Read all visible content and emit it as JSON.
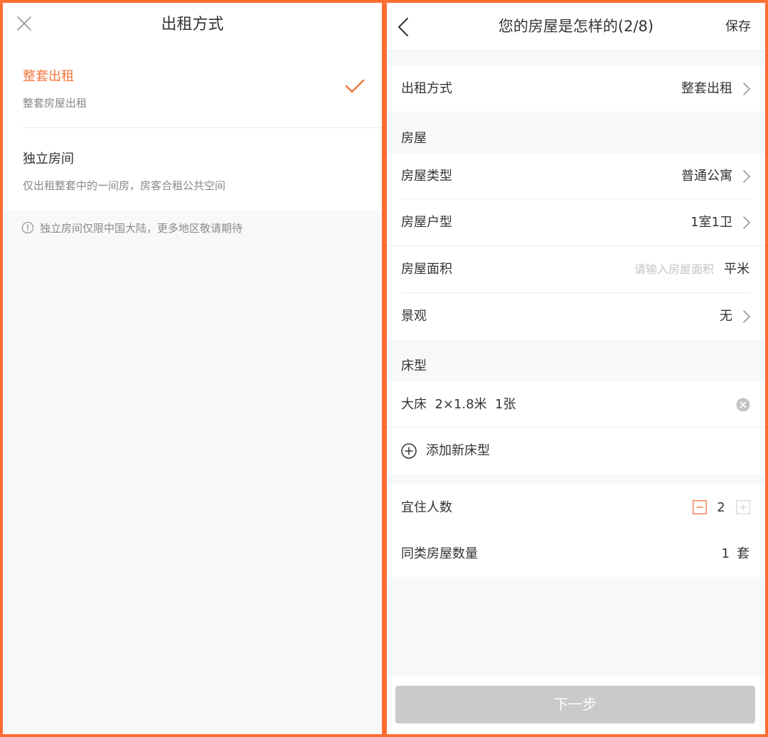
{
  "left": {
    "title": "出租方式",
    "options": [
      {
        "title": "整套出租",
        "subtitle": "整套房屋出租",
        "selected": true
      },
      {
        "title": "独立房间",
        "subtitle": "仅出租整套中的一间房，房客合租公共空间",
        "selected": false
      }
    ],
    "notice": "独立房间仅限中国大陆，更多地区敬请期待"
  },
  "right": {
    "title": "您的房屋是怎样的(2/8)",
    "save_label": "保存",
    "rental_method": {
      "label": "出租方式",
      "value": "整套出租"
    },
    "house_section": "房屋",
    "house_type": {
      "label": "房屋类型",
      "value": "普通公寓"
    },
    "layout": {
      "label": "房屋户型",
      "value": "1室1卫"
    },
    "area": {
      "label": "房屋面积",
      "placeholder": "请输入房屋面积",
      "unit": "平米"
    },
    "view": {
      "label": "景观",
      "value": "无"
    },
    "bed_section": "床型",
    "bed_item": "大床  2×1.8米  1张",
    "add_bed_label": "添加新床型",
    "guests": {
      "label": "宜住人数",
      "value": "2"
    },
    "room_count": {
      "label": "同类房屋数量",
      "value": "1",
      "unit": "套"
    },
    "next_label": "下一步"
  },
  "colors": {
    "accent": "#f5753a",
    "frame": "#ff6e30",
    "disabled_button": "#cacaca",
    "background": "#f7f8fa"
  },
  "icons": [
    "close-icon",
    "check-icon",
    "info-icon",
    "back-icon",
    "chevron-right-icon",
    "clear-icon",
    "add-circle-icon",
    "minus-icon",
    "plus-icon"
  ]
}
